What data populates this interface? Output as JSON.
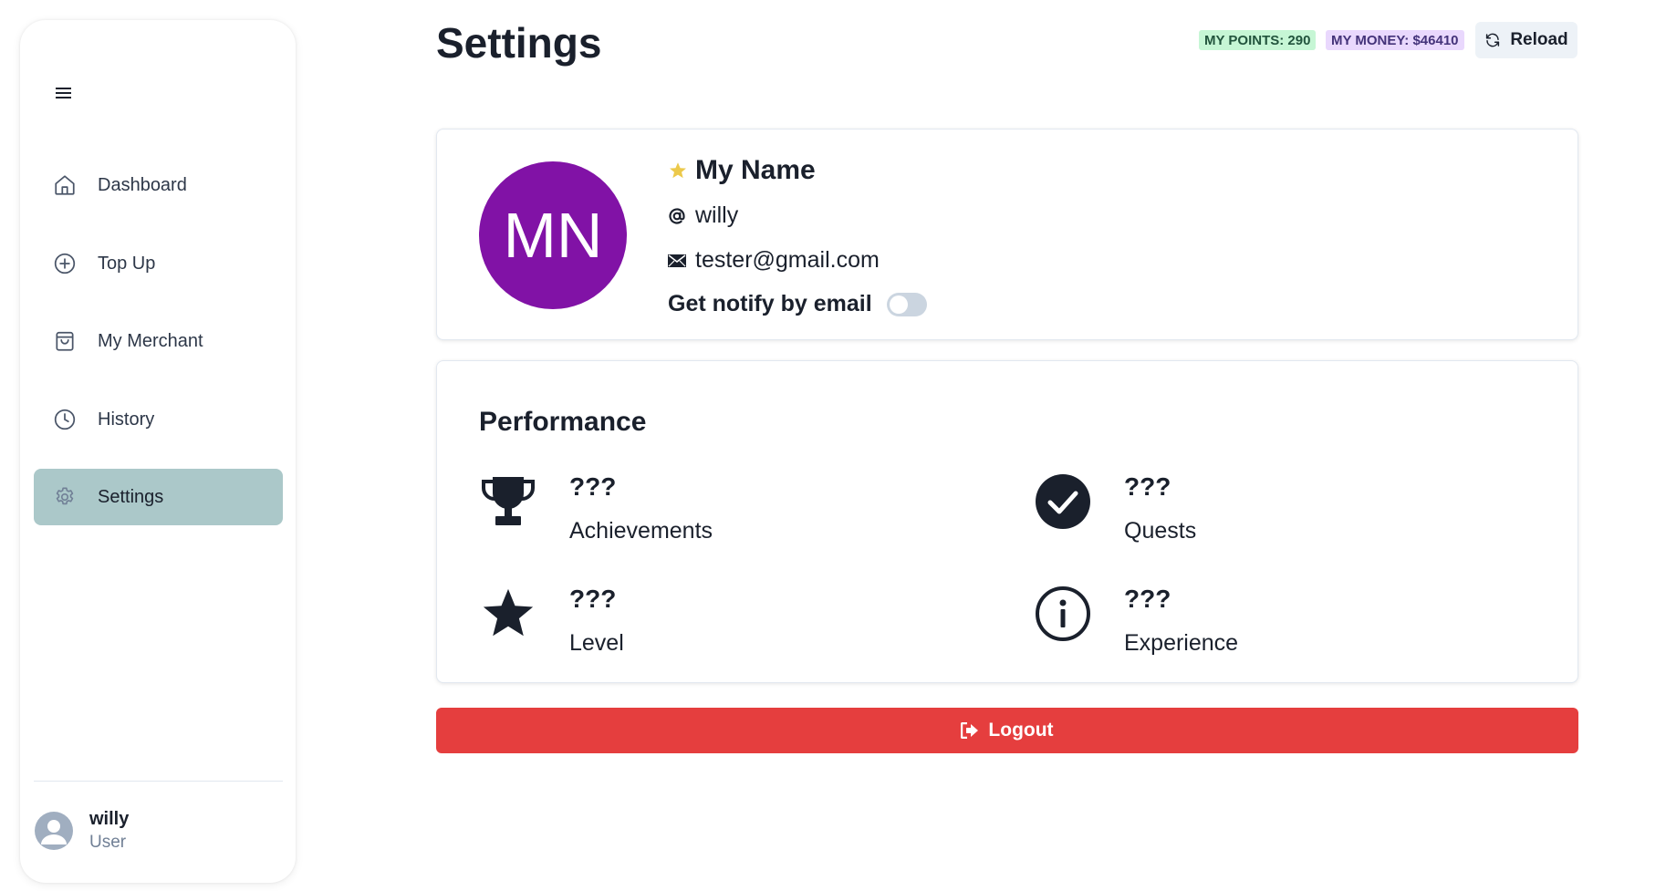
{
  "sidebar": {
    "items": [
      {
        "label": "Dashboard",
        "icon": "home-icon"
      },
      {
        "label": "Top Up",
        "icon": "plus-circle-icon"
      },
      {
        "label": "My Merchant",
        "icon": "shopping-bag-icon"
      },
      {
        "label": "History",
        "icon": "clock-icon"
      },
      {
        "label": "Settings",
        "icon": "gear-icon",
        "active": true
      }
    ],
    "user": {
      "name": "willy",
      "role": "User"
    }
  },
  "header": {
    "title": "Settings",
    "points_badge": "MY POINTS: 290",
    "money_badge": "MY MONEY: $46410",
    "reload_label": "Reload"
  },
  "profile": {
    "initials": "MN",
    "name": "My Name",
    "username": "willy",
    "email": "tester@gmail.com",
    "notify_label": "Get notify by email",
    "notify_enabled": false,
    "avatar_color": "#8112a6"
  },
  "performance": {
    "title": "Performance",
    "stats": [
      {
        "value": "???",
        "label": "Achievements",
        "icon": "trophy-icon"
      },
      {
        "value": "???",
        "label": "Quests",
        "icon": "check-circle-icon"
      },
      {
        "value": "???",
        "label": "Level",
        "icon": "star-icon"
      },
      {
        "value": "???",
        "label": "Experience",
        "icon": "info-circle-icon"
      }
    ]
  },
  "logout_label": "Logout",
  "colors": {
    "active_nav": "#abc8c9",
    "logout": "#e53e3e",
    "points_bg": "#c6f6d5",
    "money_bg": "#e9d8fd",
    "star": "#ecc94b"
  }
}
